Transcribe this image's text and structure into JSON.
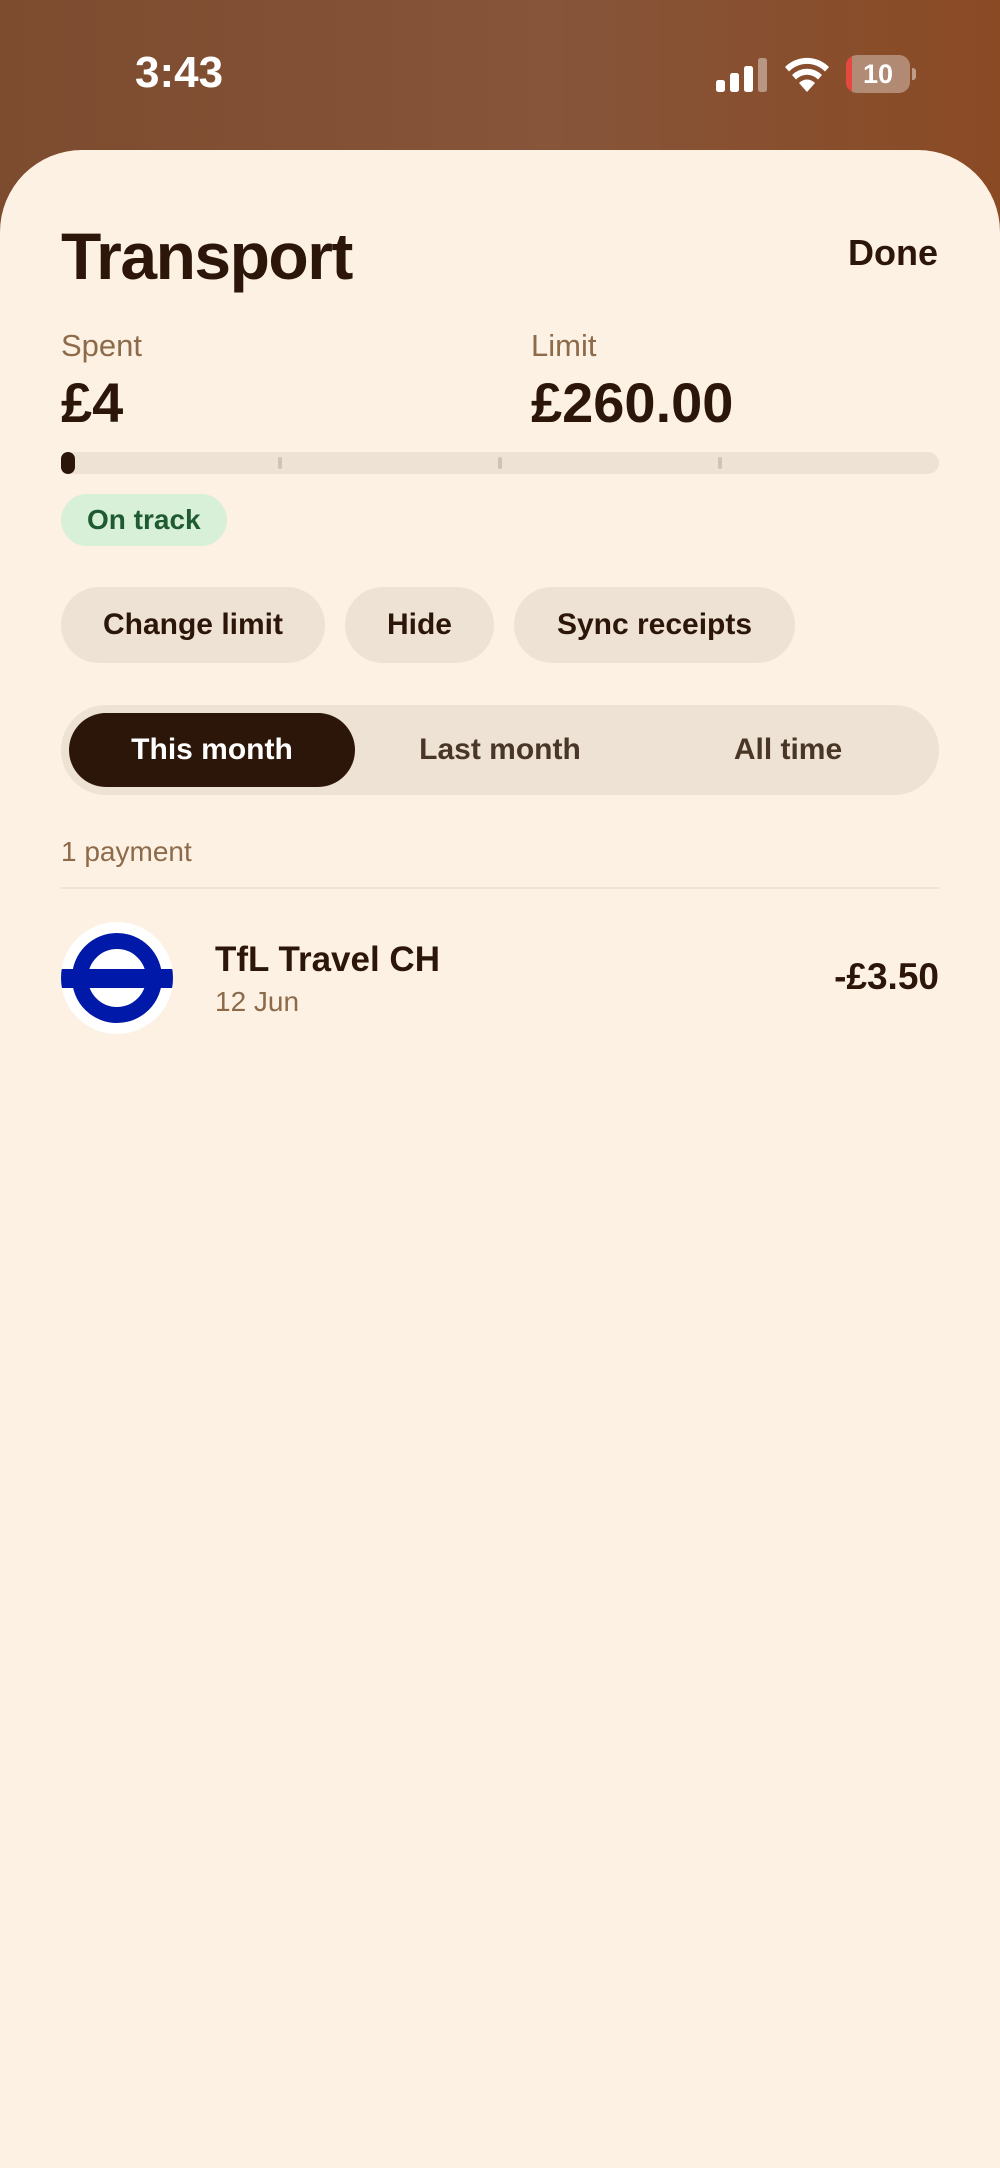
{
  "status_bar": {
    "time": "3:43",
    "battery_level": "10",
    "battery_fraction": 0.1,
    "signal_bars_filled": 3,
    "signal_bars_total": 4,
    "icons": [
      "signal-icon",
      "wifi-icon",
      "battery-icon"
    ]
  },
  "header": {
    "title": "Transport",
    "done_label": "Done"
  },
  "summary": {
    "spent_label": "Spent",
    "spent_value": "£4",
    "limit_label": "Limit",
    "limit_value": "£260.00",
    "progress_fraction": 0.015,
    "status_badge": "On track"
  },
  "actions": {
    "change_limit": "Change limit",
    "hide": "Hide",
    "sync_receipts": "Sync receipts"
  },
  "period_tabs": [
    {
      "label": "This month",
      "active": true
    },
    {
      "label": "Last month",
      "active": false
    },
    {
      "label": "All time",
      "active": false
    }
  ],
  "payments": {
    "count_label": "1 payment",
    "items": [
      {
        "merchant": "TfL Travel CH",
        "date": "12 Jun",
        "amount": "-£3.50",
        "logo": "tfl-roundel-icon"
      }
    ]
  },
  "colors": {
    "background": "#fdf1e3",
    "text_primary": "#2c160a",
    "text_secondary": "#8d6a4a",
    "pill_bg": "#ede2d3",
    "badge_bg": "#d8efd8",
    "badge_text": "#1e5b31",
    "tfl_blue": "#0019a8",
    "battery_low": "#e5483f"
  }
}
